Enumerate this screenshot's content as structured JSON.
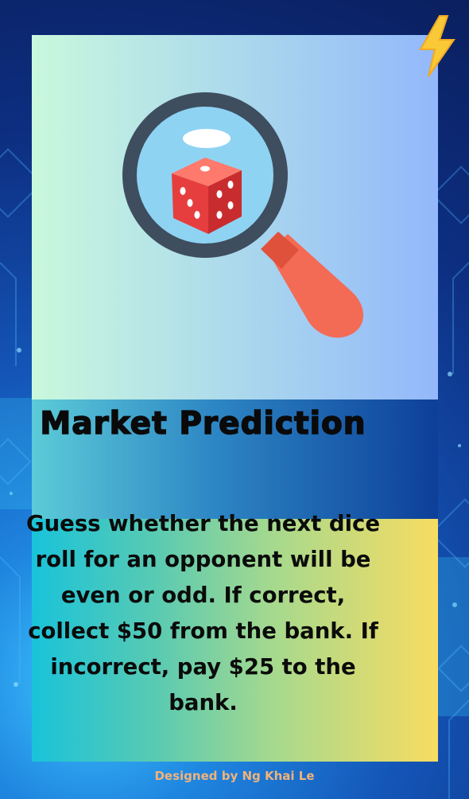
{
  "card": {
    "title": "Market Prediction",
    "description": "Guess whether the next dice roll for an opponent will be even or odd. If correct, collect $50 from the bank. If incorrect, pay $25 to the bank.",
    "illustration": "magnifying-glass-dice-icon",
    "corner_icon": "lightning-bolt-icon"
  },
  "footer": {
    "credit": "Designed by Ng Khai Le"
  },
  "colors": {
    "title_text": "#0a0a0a",
    "credit_text": "#f2b27a",
    "bolt": "#f9c937",
    "dice": "#e63e3e",
    "handle": "#f36b55",
    "lens_frame": "#3e4e5f"
  }
}
